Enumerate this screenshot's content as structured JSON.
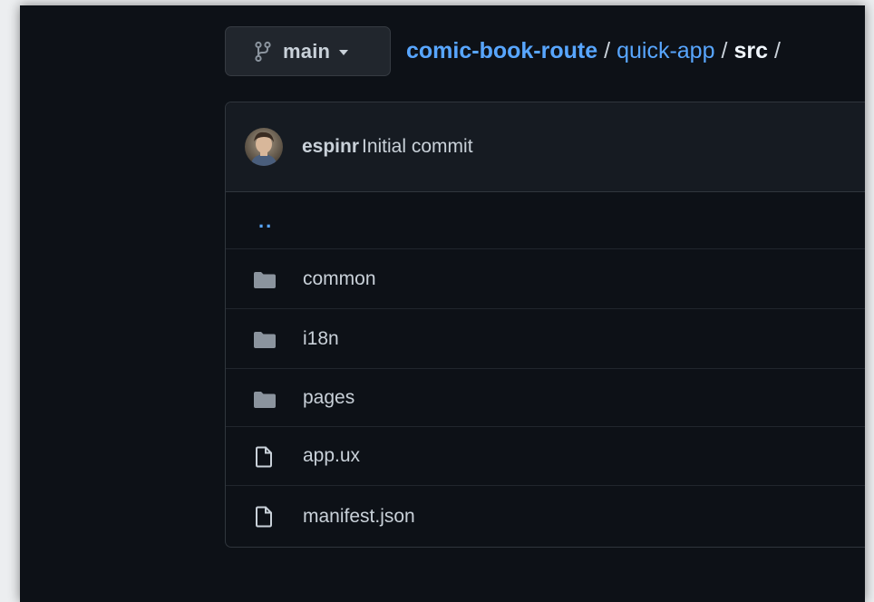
{
  "branch": {
    "name": "main",
    "icon": "git-branch-icon",
    "caret_icon": "triangle-down-icon"
  },
  "breadcrumb": {
    "repo": "comic-book-route",
    "separator": "/",
    "folder": "quick-app",
    "current": "src",
    "trailing": "/"
  },
  "commit": {
    "author": "espinr",
    "message": "Initial commit"
  },
  "files": {
    "parent": "..",
    "items": [
      {
        "name": "common",
        "type": "folder",
        "icon": "folder-icon"
      },
      {
        "name": "i18n",
        "type": "folder",
        "icon": "folder-icon"
      },
      {
        "name": "pages",
        "type": "folder",
        "icon": "folder-icon"
      },
      {
        "name": "app.ux",
        "type": "file",
        "icon": "file-icon"
      },
      {
        "name": "manifest.json",
        "type": "file",
        "icon": "file-icon"
      }
    ]
  },
  "colors": {
    "background": "#0d1117",
    "link": "#58a6ff",
    "text": "#c9d1d9",
    "border": "#30363d",
    "header_bg": "#161b22",
    "icon": "#8b949e"
  }
}
